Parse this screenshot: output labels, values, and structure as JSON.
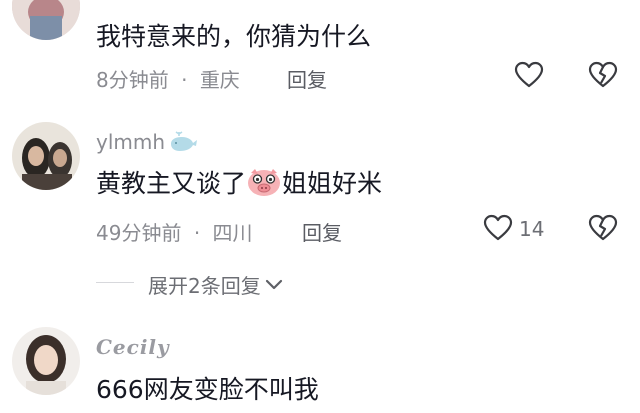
{
  "comments": [
    {
      "text": "我特意来的，你猜为什么",
      "time": "8分钟前",
      "location": "重庆",
      "reply_label": "回复"
    },
    {
      "username": "ylmmh",
      "text_part1": "黄教主又谈了",
      "text_part2": "姐姐好米",
      "time": "49分钟前",
      "location": "四川",
      "reply_label": "回复",
      "like_count": "14",
      "expand_label": "展开2条回复"
    },
    {
      "username": "Cecily",
      "text": "666网友变脸不叫我"
    }
  ],
  "separator": "·",
  "icons": {
    "like": "heart-outline-icon",
    "dislike": "broken-heart-icon",
    "expand": "chevron-down-icon",
    "verified": "whale-icon",
    "emoji": "pig-face-emoji"
  }
}
